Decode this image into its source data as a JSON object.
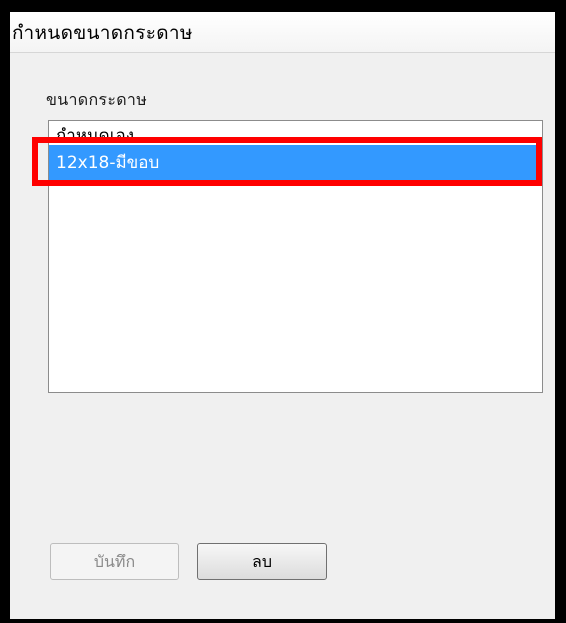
{
  "window": {
    "title": "กำหนดขนาดกระดาษ"
  },
  "paper_size": {
    "label": "ขนาดกระดาษ",
    "items": [
      {
        "label": "กำหนดเอง",
        "selected": false
      },
      {
        "label": "12x18-มีขอบ",
        "selected": true
      }
    ]
  },
  "buttons": {
    "save_label": "บันทึก",
    "save_enabled": false,
    "delete_label": "ลบ"
  },
  "colors": {
    "selection": "#3399ff",
    "highlight_annotation": "#ff0000"
  }
}
